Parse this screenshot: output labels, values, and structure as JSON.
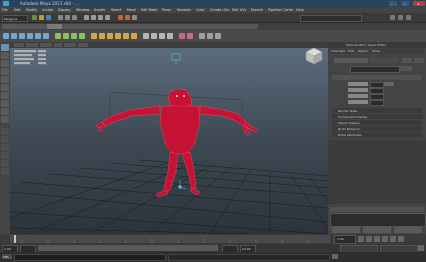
{
  "title_bar": {
    "title": "Autodesk Maya 2013 x64 - ...",
    "minimize": "_",
    "maximize": "□",
    "close": "×"
  },
  "menubar": {
    "items": [
      "File",
      "Edit",
      "Modify",
      "Create",
      "Display",
      "Window",
      "Assets",
      "Select",
      "Mesh",
      "Edit Mesh",
      "Proxy",
      "Normals",
      "Color",
      "Create UVs",
      "Edit UVs",
      "Muscle",
      "Pipeline Cache",
      "Help"
    ]
  },
  "mode_select": {
    "value": "Polygons"
  },
  "channel_box": {
    "header": "Channel Box / Layer Editor",
    "search_field": "",
    "sections": [
      "Channels",
      "Edit",
      "Object",
      "Show"
    ]
  },
  "attribute_editor": {
    "header": "Attribute Editor",
    "title_field": "",
    "rows": [
      "Render Stats",
      "Component Display",
      "Object Display",
      "Node Behavior",
      "Extra Attributes"
    ]
  },
  "time_slider": {
    "ticks": [
      "1",
      "3",
      "5",
      "7",
      "9",
      "11",
      "13",
      "15",
      "17",
      "19",
      "21",
      "23"
    ],
    "current_frame": "1.00"
  },
  "range_slider": {
    "start": "1.00",
    "end": "24.00",
    "label": "No Anim Layer",
    "char": "No Character Set"
  },
  "command_line": {
    "label": "MEL"
  },
  "colors": {
    "title_bar": "#27435d",
    "panel": "#444444",
    "character": "#c41334",
    "grid": "#1a1a1a",
    "selection_highlight": "#5ec4d8"
  }
}
